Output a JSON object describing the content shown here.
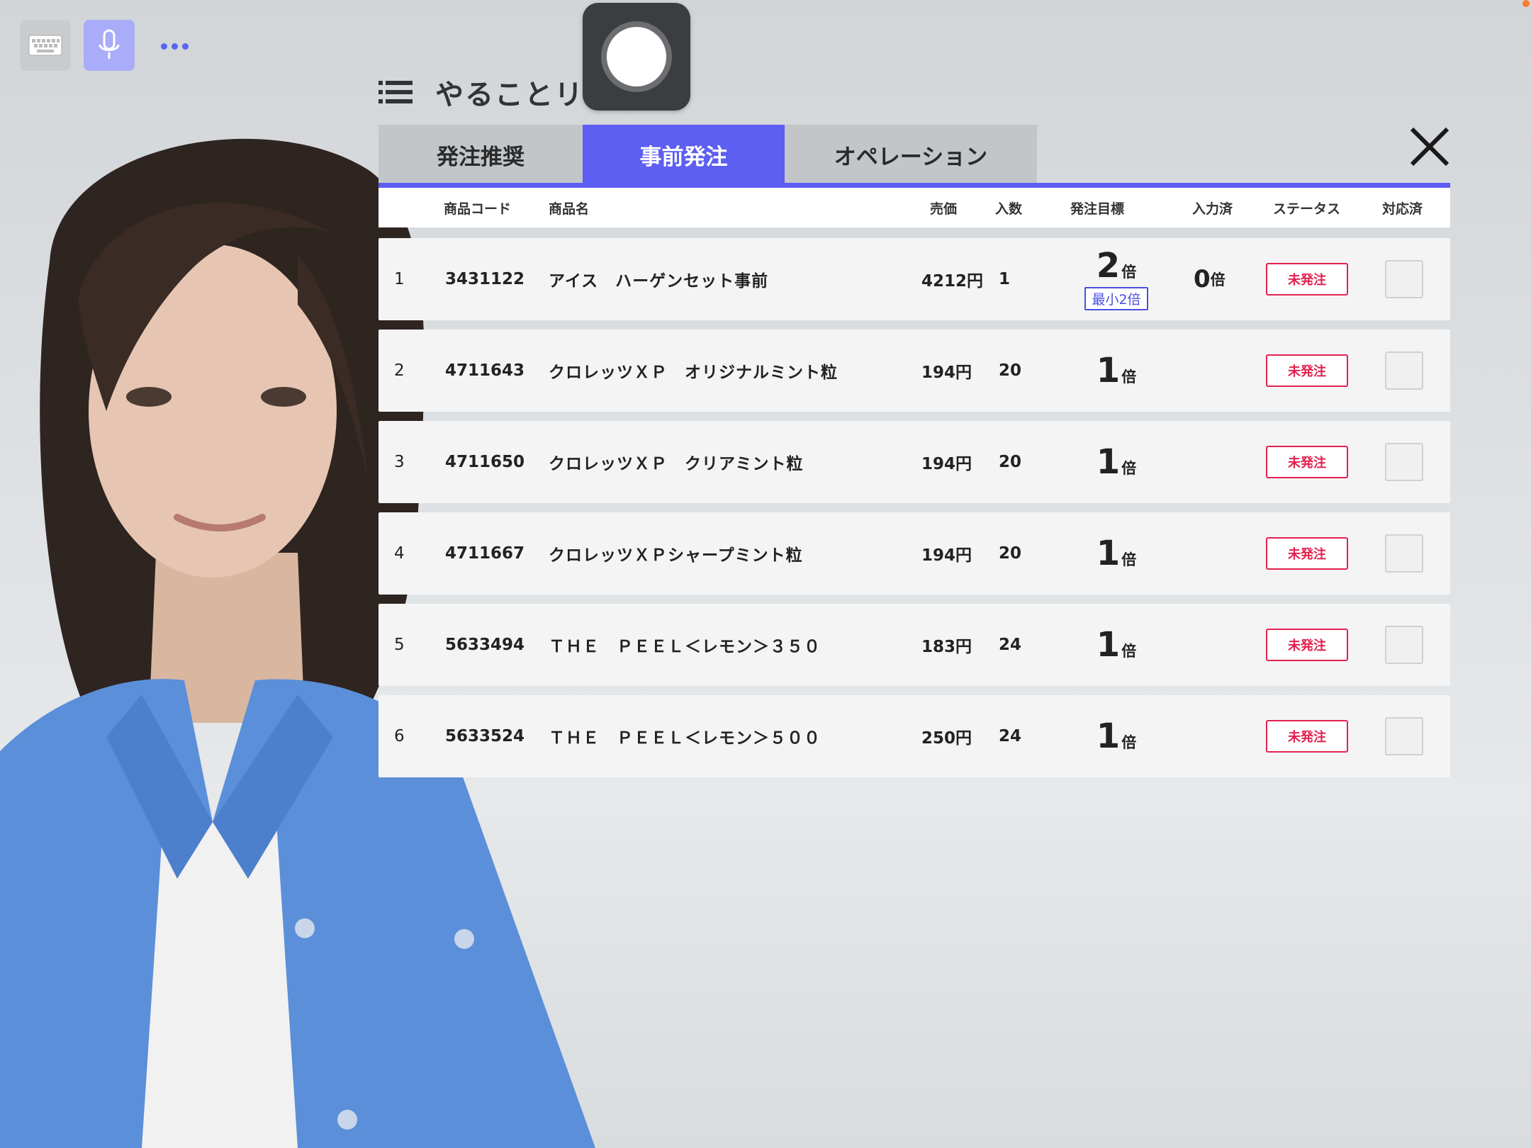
{
  "toolbar": {
    "keyboard_icon": "keyboard-icon",
    "mic_icon": "microphone-icon",
    "more_icon": "more-dots-icon"
  },
  "record_button": {
    "icon": "record-icon"
  },
  "title": {
    "text": "やることリスト",
    "icon": "list-icon"
  },
  "tabs": [
    {
      "label": "発注推奨",
      "active": false
    },
    {
      "label": "事前発注",
      "active": true
    },
    {
      "label": "オペレーション",
      "active": false
    }
  ],
  "close_icon": "close-icon",
  "table": {
    "headers": {
      "code": "商品コード",
      "name": "商品名",
      "price": "売価",
      "qty": "入数",
      "target": "発注目標",
      "input": "入力済",
      "status": "ステータス",
      "done": "対応済"
    },
    "rows": [
      {
        "no": "1",
        "code": "3431122",
        "name": "アイス　ハーゲンセット事前",
        "price": "4212円",
        "qty": "1",
        "target": "2",
        "target_unit": "倍",
        "min_label": "最小2倍",
        "input": "0",
        "input_unit": "倍",
        "status": "未発注",
        "done": false
      },
      {
        "no": "2",
        "code": "4711643",
        "name": "クロレッツＸＰ　オリジナルミント粒",
        "price": "194円",
        "qty": "20",
        "target": "1",
        "target_unit": "倍",
        "min_label": "",
        "input": "",
        "input_unit": "",
        "status": "未発注",
        "done": false
      },
      {
        "no": "3",
        "code": "4711650",
        "name": "クロレッツＸＰ　クリアミント粒",
        "price": "194円",
        "qty": "20",
        "target": "1",
        "target_unit": "倍",
        "min_label": "",
        "input": "",
        "input_unit": "",
        "status": "未発注",
        "done": false
      },
      {
        "no": "4",
        "code": "4711667",
        "name": "クロレッツＸＰシャープミント粒",
        "price": "194円",
        "qty": "20",
        "target": "1",
        "target_unit": "倍",
        "min_label": "",
        "input": "",
        "input_unit": "",
        "status": "未発注",
        "done": false
      },
      {
        "no": "5",
        "code": "5633494",
        "name": "ＴＨＥ　ＰＥＥＬ＜レモン＞３５０",
        "price": "183円",
        "qty": "24",
        "target": "1",
        "target_unit": "倍",
        "min_label": "",
        "input": "",
        "input_unit": "",
        "status": "未発注",
        "done": false
      },
      {
        "no": "6",
        "code": "5633524",
        "name": "ＴＨＥ　ＰＥＥＬ＜レモン＞５００",
        "price": "250円",
        "qty": "24",
        "target": "1",
        "target_unit": "倍",
        "min_label": "",
        "input": "",
        "input_unit": "",
        "status": "未発注",
        "done": false
      }
    ]
  },
  "colors": {
    "accent": "#5d5ef2",
    "status_red": "#e2214f",
    "tab_inactive": "#c3c6c9"
  }
}
